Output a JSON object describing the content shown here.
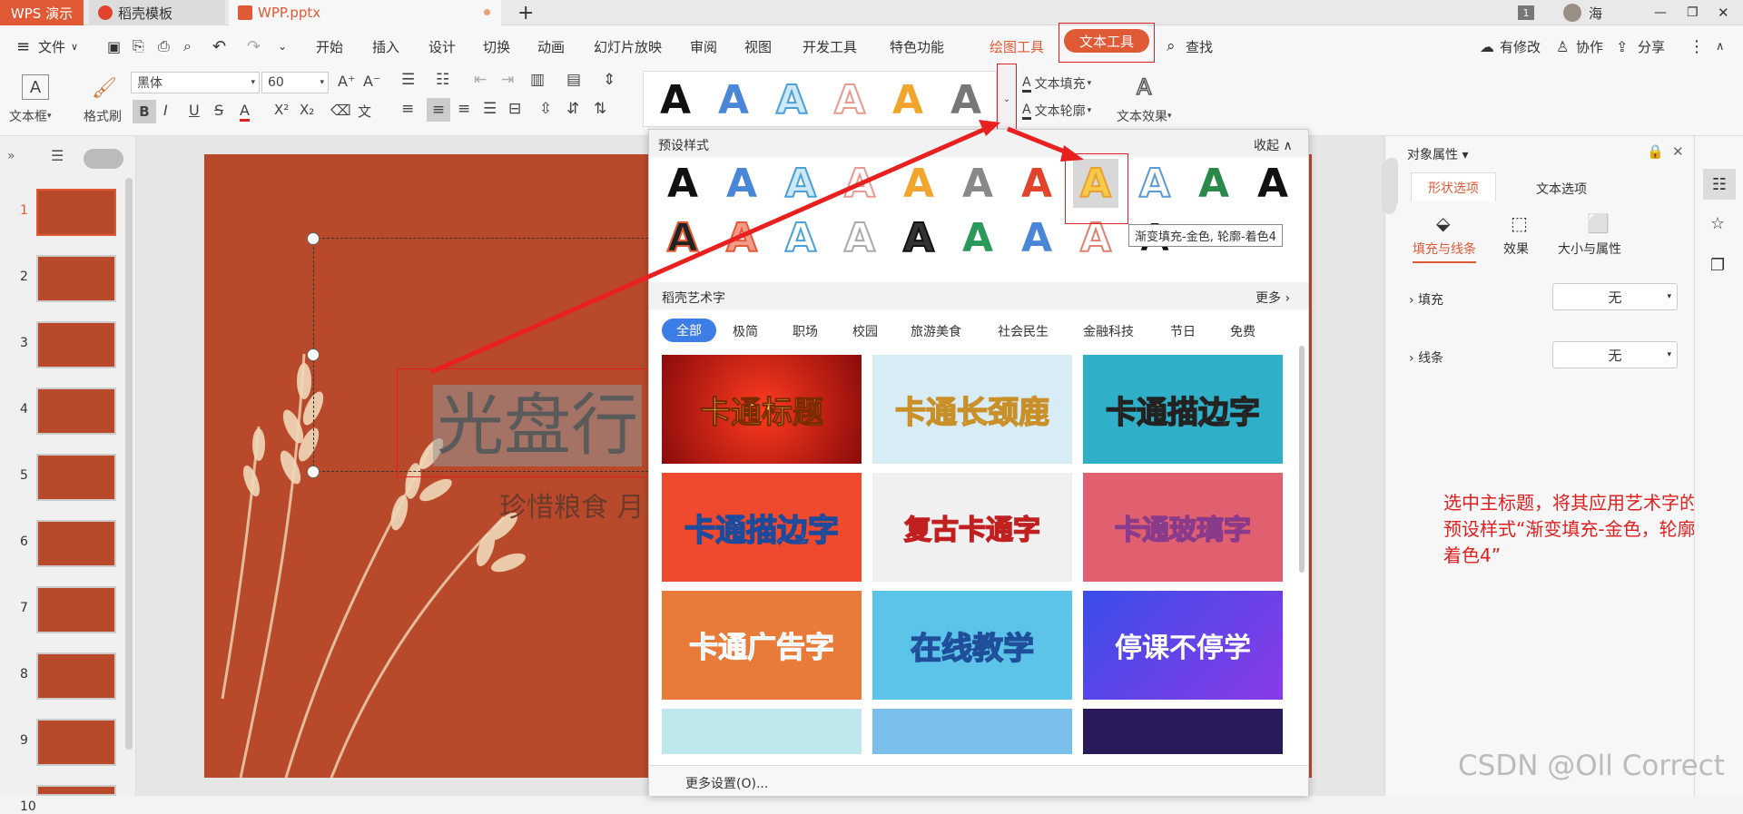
{
  "tabs": {
    "app": "WPS 演示",
    "template": "稻壳模板",
    "file": "WPP.pptx",
    "add": "+",
    "user": "海",
    "badge": "1"
  },
  "menu": {
    "file": "文件",
    "items": [
      "开始",
      "插入",
      "设计",
      "切换",
      "动画",
      "幻灯片放映",
      "审阅",
      "视图",
      "开发工具",
      "特色功能"
    ],
    "drawing_tools": "绘图工具",
    "text_tools": "文本工具",
    "search": "查找",
    "modified": "有修改",
    "collab": "协作",
    "share": "分享"
  },
  "ribbon": {
    "textbox": "文本框",
    "format_painter": "格式刷",
    "font_name": "黑体",
    "font_size": "60",
    "text_fill": "文本填充",
    "text_outline": "文本轮廓",
    "text_effects": "文本效果",
    "art_letter": "A"
  },
  "slides": [
    "1",
    "2",
    "3",
    "4",
    "5",
    "6",
    "7",
    "8",
    "9",
    "10"
  ],
  "canvas": {
    "title": "光盘行",
    "subtitle": "珍惜粮食 月"
  },
  "panel": {
    "preset_title": "预设样式",
    "collapse": "收起",
    "tooltip": "渐变填充-金色, 轮廓-着色4",
    "daoke_title": "稻壳艺术字",
    "more": "更多",
    "categories": [
      "全部",
      "极简",
      "职场",
      "校园",
      "旅游美食",
      "社会民生",
      "金融科技",
      "节日",
      "免费"
    ],
    "cards": [
      "卡通标题",
      "卡通长颈鹿",
      "卡通描边字",
      "卡通描边字",
      "复古卡通字",
      "卡通玻璃字",
      "卡通广告字",
      "在线教学",
      "停课不停学"
    ],
    "more_settings": "更多设置(O)..."
  },
  "right_panel": {
    "title": "对象属性",
    "tab_shape": "形状选项",
    "tab_text": "文本选项",
    "sub_fill": "填充与线条",
    "sub_effect": "效果",
    "sub_size": "大小与属性",
    "fill_label": "填充",
    "fill_value": "无",
    "line_label": "线条",
    "line_value": "无"
  },
  "annotation": "选中主标题，将其应用艺术字的预设样式“渐变填充-金色，轮廓-着色4”",
  "watermark": "CSDN @Oll Correct"
}
